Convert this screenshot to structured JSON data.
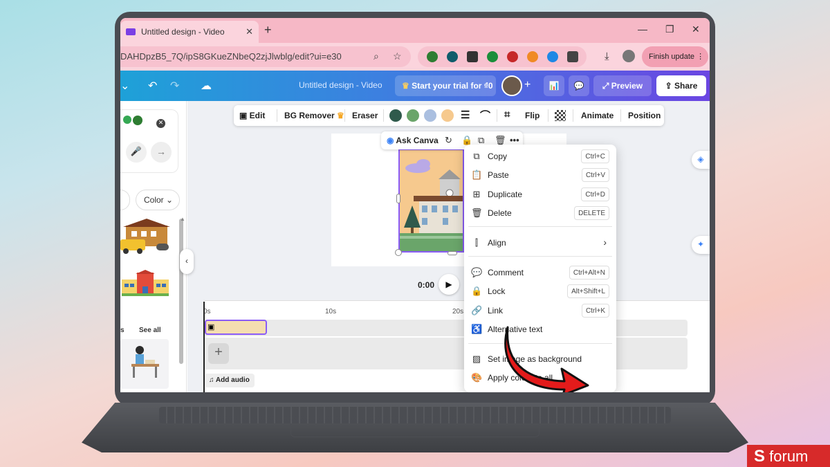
{
  "browser": {
    "tab_title": "Untitled design - Video",
    "tab_close": "✕",
    "new_tab": "+",
    "win_min": "—",
    "win_max": "❐",
    "win_close": "✕",
    "url": "DAHDpzB5_7Q/ipS8GKueZNbeQ2zjJlwblg/edit?ui=e30",
    "finish_update": "Finish update",
    "ext_colors": [
      "#2e7d32",
      "#0f5c6b",
      "#333333",
      "#1b8e3a",
      "#c62828",
      "#f08a24",
      "#1e88e5",
      "#444444"
    ]
  },
  "header": {
    "doc_title": "Untitled design - Video",
    "trial_label": "Start your trial for ₫0",
    "preview_label": "Preview",
    "share_label": "Share"
  },
  "left_panel": {
    "color_filter": "Color",
    "see_all": "See all",
    "section_fragment": "s"
  },
  "toolbar": {
    "edit": "Edit",
    "bg_remover": "BG Remover",
    "eraser": "Eraser",
    "flip": "Flip",
    "animate": "Animate",
    "position": "Position",
    "swatches": [
      "#2f5a4c",
      "#6aa56a",
      "#aabfe0",
      "#f6c98e"
    ]
  },
  "minibar": {
    "ask_canva": "Ask Canva"
  },
  "playback": {
    "time": "0:00"
  },
  "timeline": {
    "labels": [
      "0s",
      "10s",
      "20s"
    ],
    "add_audio": "Add audio"
  },
  "context_menu": {
    "items": [
      {
        "icon": "copy-icon",
        "label": "Copy",
        "shortcut": "Ctrl+C"
      },
      {
        "icon": "paste-icon",
        "label": "Paste",
        "shortcut": "Ctrl+V"
      },
      {
        "icon": "duplicate-icon",
        "label": "Duplicate",
        "shortcut": "Ctrl+D"
      },
      {
        "icon": "delete-icon",
        "label": "Delete",
        "shortcut": "DELETE"
      },
      {
        "icon": "align-icon",
        "label": "Align",
        "shortcut": ""
      },
      {
        "icon": "comment-icon",
        "label": "Comment",
        "shortcut": "Ctrl+Alt+N"
      },
      {
        "icon": "lock-icon",
        "label": "Lock",
        "shortcut": "Alt+Shift+L"
      },
      {
        "icon": "link-icon",
        "label": "Link",
        "shortcut": "Ctrl+K"
      },
      {
        "icon": "accessibility-icon",
        "label": "Alternative text",
        "shortcut": ""
      },
      {
        "icon": "background-icon",
        "label": "Set image as background",
        "shortcut": ""
      },
      {
        "icon": "palette-icon",
        "label": "Apply colors to all",
        "shortcut": ""
      }
    ]
  },
  "watermark": {
    "brand": "forum"
  }
}
